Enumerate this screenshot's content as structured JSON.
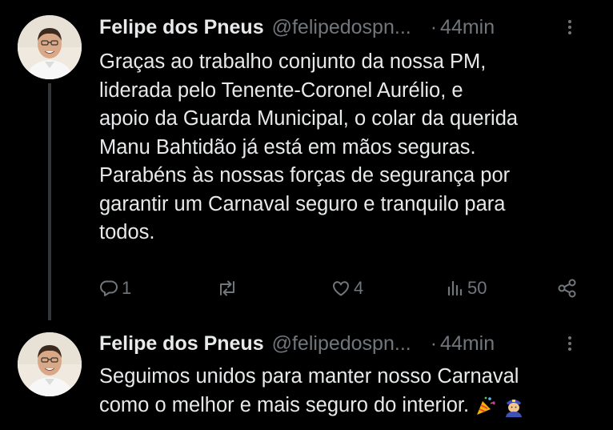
{
  "tweets": [
    {
      "author": {
        "name": "Felipe dos Pneus",
        "handle": "@felipedospn..."
      },
      "separator": "·",
      "time": "44min",
      "text": "Graças ao trabalho conjunto da nossa PM,\nliderada pelo Tenente-Coronel Aurélio, e\napoio da Guarda Municipal, o colar da querida\nManu Bahtidão já está em mãos seguras.\nParabéns às nossas forças de segurança por\ngarantir um Carnaval seguro e tranquilo para\ntodos.",
      "stats": {
        "replies": "1",
        "reposts": "",
        "likes": "4",
        "views": "50"
      }
    },
    {
      "author": {
        "name": "Felipe dos Pneus",
        "handle": "@felipedospn..."
      },
      "separator": "·",
      "time": "44min",
      "text": "Seguimos unidos para manter nosso Carnaval\ncomo o melhor e mais seguro do interior. ",
      "emojis": [
        "party-popper-icon",
        "police-officer-icon"
      ]
    }
  ],
  "colors": {
    "background": "#000000",
    "text": "#e7e9ea",
    "muted": "#71767b",
    "thread_line": "#333639"
  }
}
